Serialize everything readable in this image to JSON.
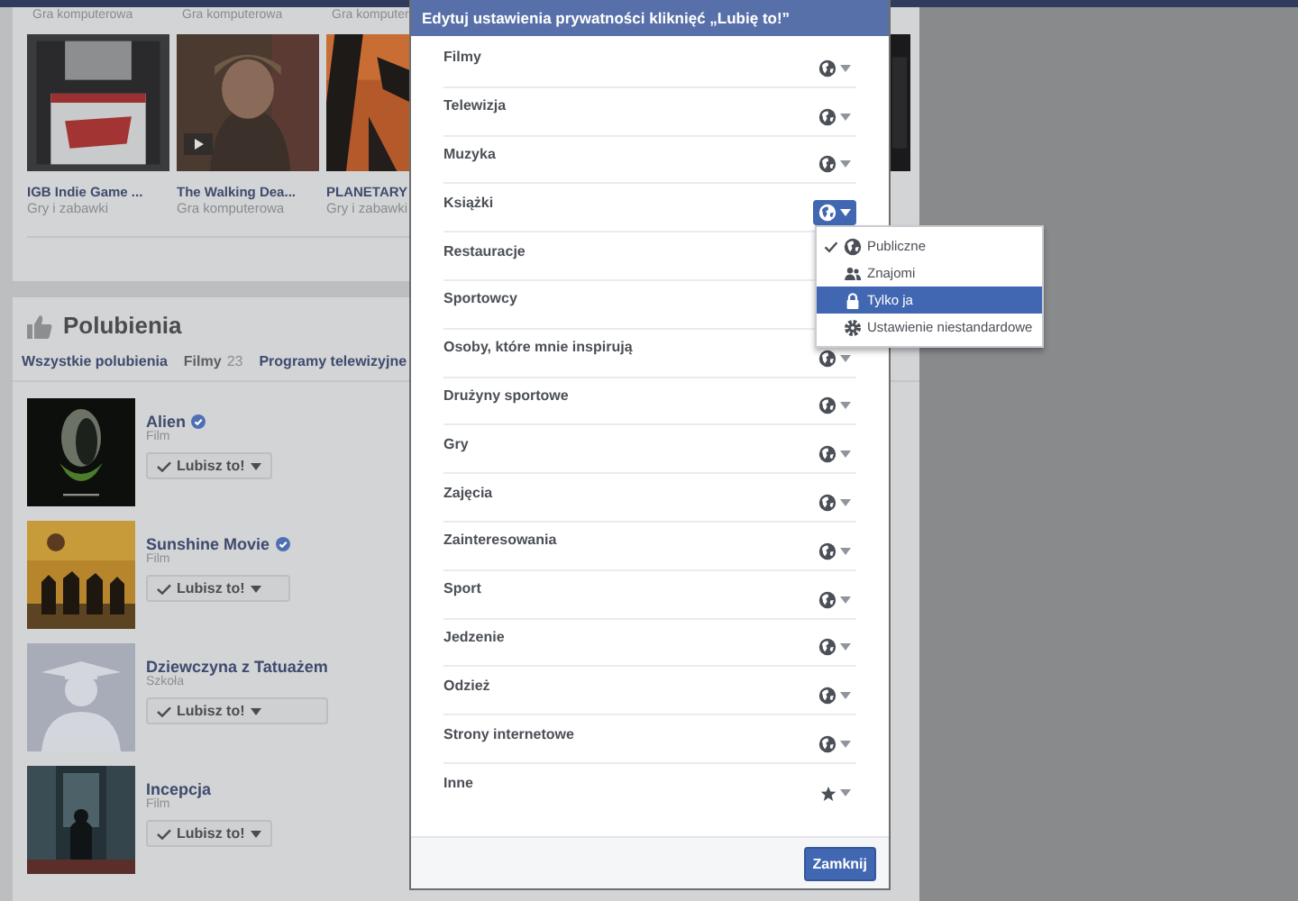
{
  "games": {
    "above": [
      "Gra komputerowa",
      "Gra komputerowa",
      "Gra komputer"
    ],
    "items": [
      {
        "title": "IGB Indie Game ...",
        "category": "Gry i zabawki",
        "video": false
      },
      {
        "title": "The Walking Dea...",
        "category": "Gra komputerowa",
        "video": true
      },
      {
        "title": "PLANETARY",
        "category": "Gry i zabawki",
        "video": false
      }
    ]
  },
  "likes": {
    "title": "Polubienia",
    "tabs": [
      {
        "label": "Wszystkie polubienia",
        "selected": false
      },
      {
        "label": "Filmy",
        "count": "23",
        "selected": true
      },
      {
        "label": "Programy telewizyjne",
        "selected": false
      }
    ],
    "items": [
      {
        "name": "Alien",
        "verified": true,
        "category": "Film",
        "button": "Lubisz to!"
      },
      {
        "name": "Sunshine Movie",
        "verified": true,
        "category": "Film",
        "button": "Lubisz to!"
      },
      {
        "name": "Dziewczyna z Tatuażem",
        "verified": false,
        "category": "Szkoła",
        "button": "Lubisz to!"
      },
      {
        "name": "Incepcja",
        "verified": false,
        "category": "Film",
        "button": "Lubisz to!"
      }
    ]
  },
  "dialog": {
    "title": "Edytuj ustawienia prywatności kliknięć „Lubię to!”",
    "rows": [
      {
        "label": "Filmy",
        "kind": "public",
        "open": false
      },
      {
        "label": "Telewizja",
        "kind": "public",
        "open": false
      },
      {
        "label": "Muzyka",
        "kind": "public",
        "open": false
      },
      {
        "label": "Książki",
        "kind": "public",
        "open": true
      },
      {
        "label": "Restauracje"
      },
      {
        "label": "Sportowcy"
      },
      {
        "label": "Osoby, które mnie inspirują",
        "kind": "public",
        "open": false
      },
      {
        "label": "Drużyny sportowe",
        "kind": "public",
        "open": false
      },
      {
        "label": "Gry",
        "kind": "public",
        "open": false
      },
      {
        "label": "Zajęcia",
        "kind": "public",
        "open": false
      },
      {
        "label": "Zainteresowania",
        "kind": "public",
        "open": false
      },
      {
        "label": "Sport",
        "kind": "public",
        "open": false
      },
      {
        "label": "Jedzenie",
        "kind": "public",
        "open": false
      },
      {
        "label": "Odzież",
        "kind": "public",
        "open": false
      },
      {
        "label": "Strony internetowe",
        "kind": "public",
        "open": false
      },
      {
        "label": "Inne",
        "kind": "custom",
        "open": false
      }
    ],
    "menu": [
      {
        "label": "Publiczne",
        "kind": "public",
        "checked": true,
        "selected": false
      },
      {
        "label": "Znajomi",
        "kind": "friends",
        "checked": false,
        "selected": false
      },
      {
        "label": "Tylko ja",
        "kind": "only_me",
        "checked": false,
        "selected": true
      },
      {
        "label": "Ustawienie niestandardowe",
        "kind": "custom",
        "checked": false,
        "selected": false
      }
    ],
    "close_button": "Zamknij"
  }
}
